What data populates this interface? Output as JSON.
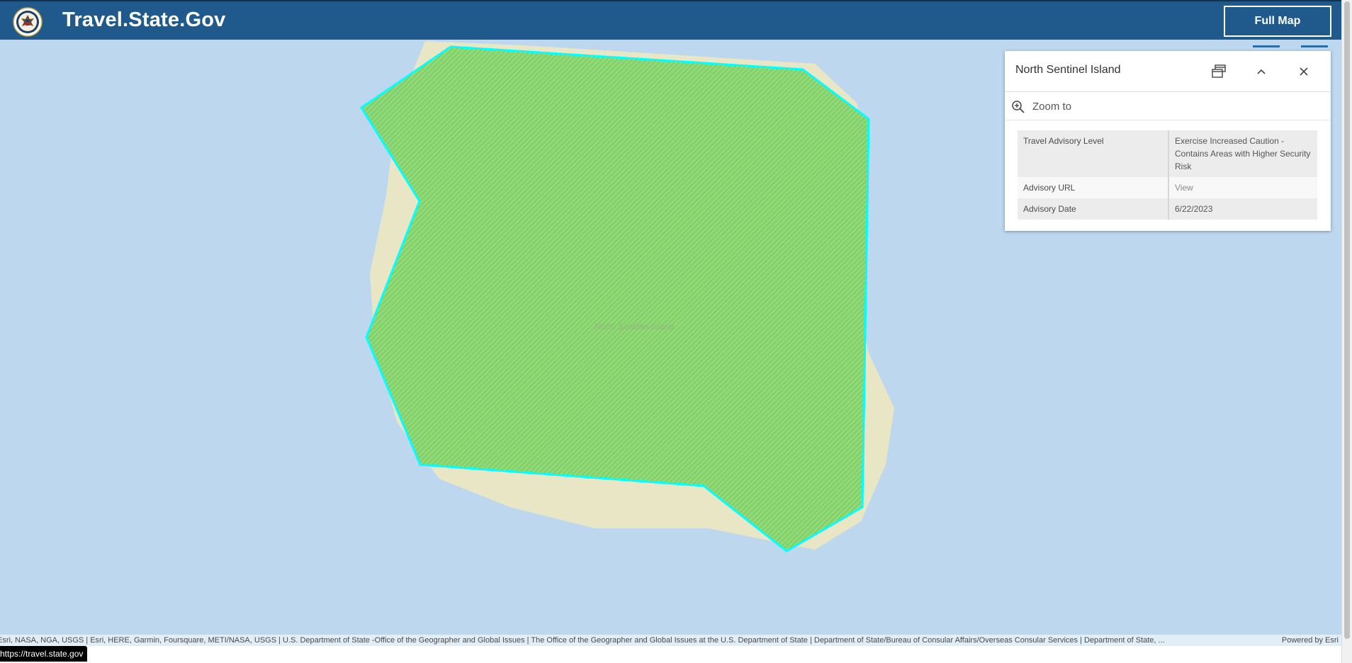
{
  "header": {
    "site_title": "Travel.State.Gov",
    "full_map_label": "Full Map",
    "seal_icon": "us-state-department-seal-icon",
    "background_color": "#205a8c"
  },
  "map": {
    "center_label": "North Sentinel Island",
    "ocean_color": "#bdd7ee",
    "land_color": "#e8e6c4",
    "highlight_fill": "#7fd36a",
    "highlight_outline": "#00ffff"
  },
  "popup": {
    "title": "North Sentinel Island",
    "zoom_label": "Zoom to",
    "rows": [
      {
        "key": "Travel Advisory Level",
        "value": "Exercise Increased Caution - Contains Areas with Higher Security Risk"
      },
      {
        "key": "Advisory URL",
        "value": "View"
      },
      {
        "key": "Advisory Date",
        "value": "6/22/2023"
      }
    ]
  },
  "attribution": {
    "text": "Esri, NASA, NGA, USGS | Esri, HERE, Garmin, Foursquare, METI/NASA, USGS | U.S. Department of State -Office of the Geographer and Global Issues | The Office of the Geographer and Global Issues at the U.S. Department of State | Department of State/Bureau of Consular Affairs/Overseas Consular Services | Department of State, ...",
    "powered_by": "Powered by Esri"
  },
  "status_bar": {
    "url": "https://travel.state.gov"
  }
}
